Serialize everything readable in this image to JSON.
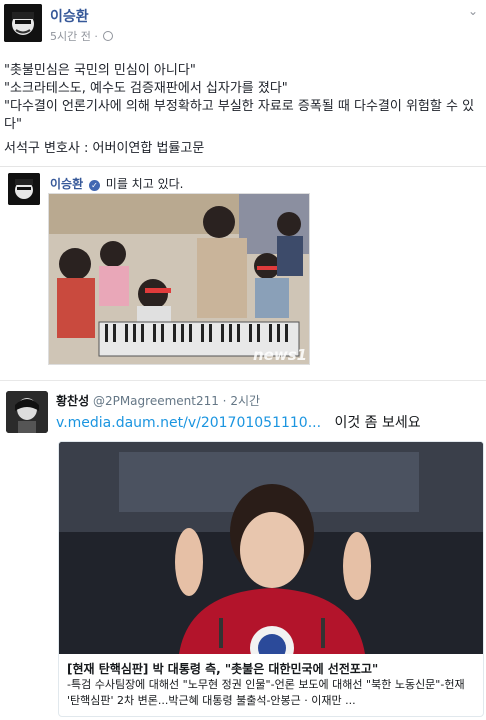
{
  "post": {
    "author": "이승환",
    "time": "5시간 전 ·",
    "lines": [
      "\"촛불민심은 국민의 민심이 아니다\"",
      "\"소크라테스도, 예수도 검증재판에서 십자가를 졌다\"",
      "\"다수결이 언론기사에 의해 부정확하고 부실한 자료로 증폭될 때 다수결이 위험할 수 있다\""
    ],
    "signature": "서석구 변호사 : 어버이연합 법률고문"
  },
  "shared": {
    "author": "이승환",
    "action": "미를 치고 있다.",
    "photo_watermark": "news1"
  },
  "tweet": {
    "name": "황찬성",
    "handle": "@2PMagreement211 · 2시간",
    "link": "v.media.daum.net/v/201701051110...",
    "text": "이것 좀 보세요",
    "card_title": "[현재 탄핵심판] 박 대통령 측, \"촛불은 대한민국에 선전포고\"",
    "card_desc": "-특검 수사팀장에 대해선 \"노무현 정권 인물\"-언론 보도에 대해선 \"북한 노동신문\"-헌재 '탄핵심판' 2차 변론...박근혜 대통령 불출석-안봉근 · 이재만 ..."
  }
}
